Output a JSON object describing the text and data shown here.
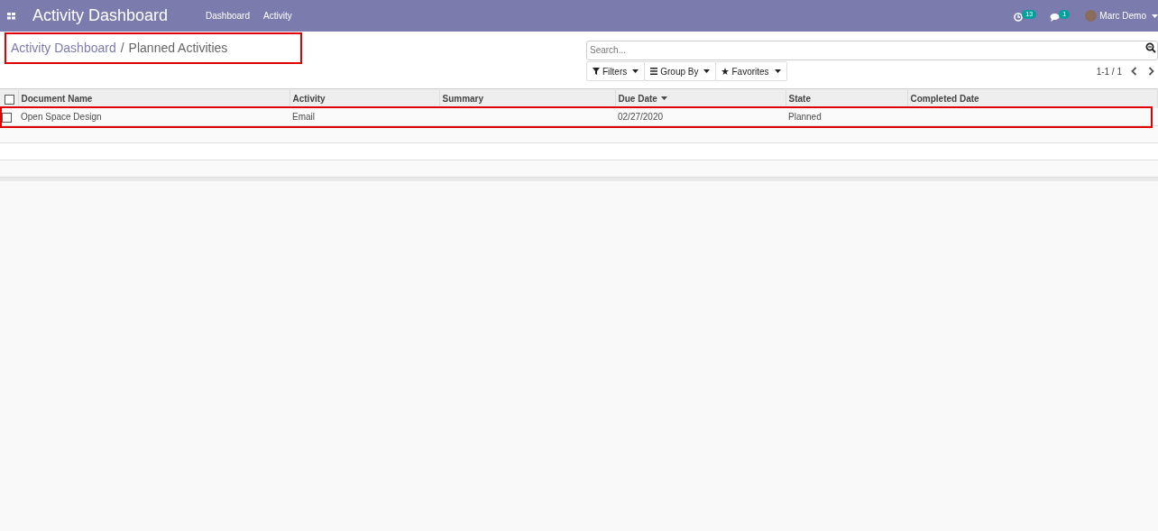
{
  "navbar": {
    "app_title": "Activity Dashboard",
    "menu": [
      {
        "label": "Dashboard"
      },
      {
        "label": "Activity"
      }
    ],
    "activity_count": "13",
    "message_count": "1",
    "user": "Marc Demo"
  },
  "breadcrumb": {
    "items": [
      "Activity Dashboard",
      "Planned Activities"
    ],
    "separator": "/",
    "highlighted": true
  },
  "search": {
    "placeholder": "Search..."
  },
  "filters": [
    {
      "kind": "filter",
      "label": "Filters"
    },
    {
      "kind": "group",
      "label": "Group By"
    },
    {
      "kind": "favorite",
      "label": "Favorites"
    }
  ],
  "pager": "1-1 / 1",
  "table": {
    "columns": [
      {
        "label": "Document Name",
        "sorted": false
      },
      {
        "label": "Activity",
        "sorted": false
      },
      {
        "label": "Summary",
        "sorted": false
      },
      {
        "label": "Due Date",
        "sorted": true
      },
      {
        "label": "State",
        "sorted": false
      },
      {
        "label": "Completed Date",
        "sorted": false
      }
    ],
    "select_all_checked": false,
    "rows": [
      {
        "cells": [
          "Open Space Design",
          "Email",
          "",
          "02/27/2020",
          "Planned",
          ""
        ],
        "checked": false,
        "highlighted": true
      }
    ]
  }
}
